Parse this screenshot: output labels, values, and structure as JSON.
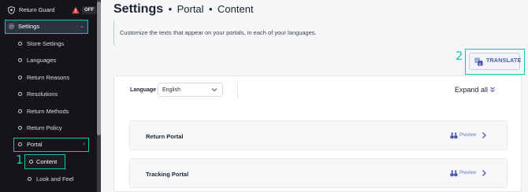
{
  "sidebar": {
    "app_name": "Return Guard",
    "status_badge": "OFF",
    "settings_label": "Settings",
    "items": [
      {
        "label": "Store Settings"
      },
      {
        "label": "Languages"
      },
      {
        "label": "Return Reasons"
      },
      {
        "label": "Resolutions"
      },
      {
        "label": "Return Methods"
      },
      {
        "label": "Return Policy"
      }
    ],
    "portal_label": "Portal",
    "content_label": "Content",
    "look_label": "Look and Feel"
  },
  "annotations": {
    "step1": "1",
    "step2": "2"
  },
  "header": {
    "title": "Settings",
    "sep1": "•",
    "crumb1": "Portal",
    "sep2": "•",
    "crumb2": "Content"
  },
  "description": "Customize the texts that appear on your portals, in each of your languages.",
  "translate_label": "TRANSLATE",
  "language": {
    "label": "Language",
    "value": "English"
  },
  "expand_label": "Expand all",
  "portals": [
    {
      "label": "Return Portal",
      "preview": "Preview"
    },
    {
      "label": "Tracking Portal",
      "preview": "Preview"
    }
  ],
  "colors": {
    "highlight": "#18c3b0",
    "accent": "#4b59a6",
    "sidebar_bg": "#14141a"
  }
}
